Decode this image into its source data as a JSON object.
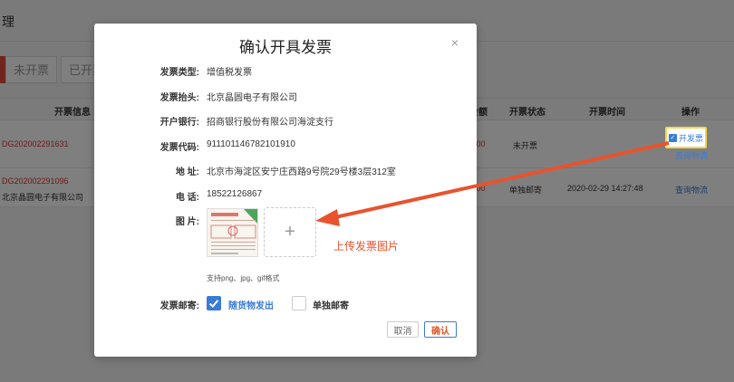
{
  "background": {
    "page_title": "理",
    "tabs": [
      "未开票",
      "已开票"
    ],
    "columns": [
      "开票信息",
      "金额",
      "开票状态",
      "开票时间",
      "操作"
    ],
    "rows": [
      {
        "order": "DG202002291631",
        "amount": "5.00",
        "status": "未开票",
        "time": "",
        "action_primary": "开发票",
        "action_secondary": "查询物流"
      },
      {
        "order": "DG202002291096",
        "title_line": "北京晶圆电子有限公司",
        "amount": "2.00",
        "status": "单独邮寄",
        "time": "2020-02-29 14:27:48",
        "action_secondary": "查询物流"
      }
    ]
  },
  "modal": {
    "title": "确认开具发票",
    "close_label": "×",
    "fields": [
      {
        "label": "发票类型:",
        "value": "增值税发票"
      },
      {
        "label": "发票抬头:",
        "value": "北京晶圆电子有限公司"
      },
      {
        "label": "开户银行:",
        "value": "招商银行股份有限公司海淀支行"
      },
      {
        "label": "发票代码:",
        "value": "911101146782101910"
      },
      {
        "label": "地 址:",
        "value": "北京市海淀区安宁庄西路9号院29号楼3层312室"
      },
      {
        "label": "电 话:",
        "value": "18522126867"
      }
    ],
    "image_label": "图 片:",
    "upload_plus": "+",
    "upload_note": "支持png、jpg、gif格式",
    "mail_label": "发票邮寄:",
    "mail_options": [
      {
        "label": "随货物发出",
        "checked": true
      },
      {
        "label": "单独邮寄",
        "checked": false
      }
    ],
    "cancel_label": "取消",
    "confirm_label": "确认"
  },
  "annotation": {
    "callout_text": "上传发票图片",
    "color": "#e8532e"
  },
  "colors": {
    "accent": "#3a7bd5",
    "highlight": "#f2d64b",
    "danger": "#d9342b"
  }
}
